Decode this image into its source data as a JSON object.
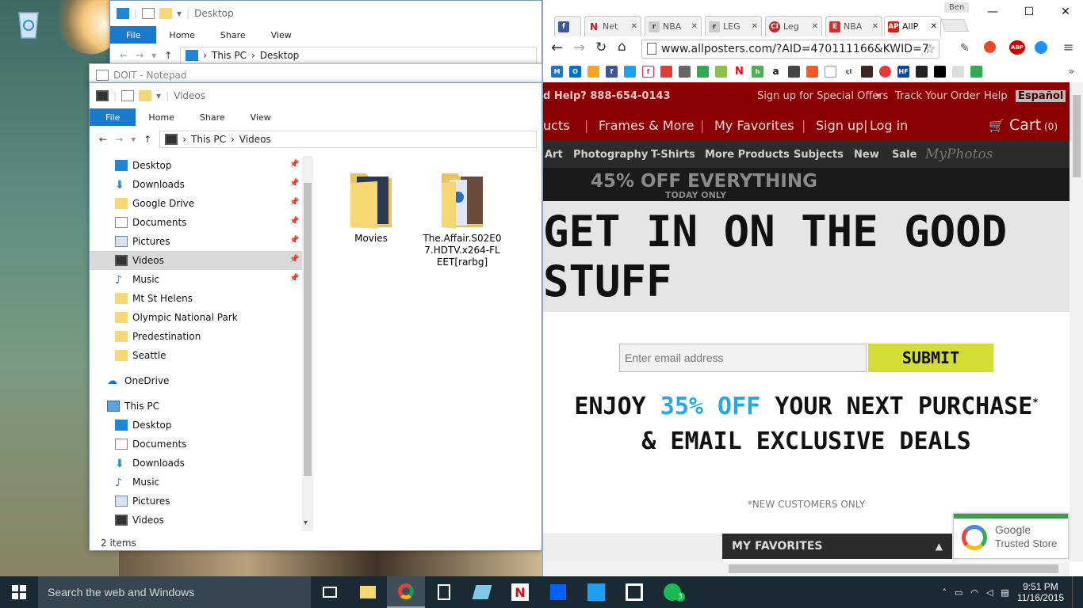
{
  "desktop": {
    "recycle_bin_label": ""
  },
  "explorer_back": {
    "title": "Desktop",
    "tabs": [
      "File",
      "Home",
      "Share",
      "View"
    ],
    "path": [
      "This PC",
      "Desktop"
    ]
  },
  "notepad": {
    "title": "DOIT - Notepad"
  },
  "explorer": {
    "title": "Videos",
    "tabs": [
      "File",
      "Home",
      "Share",
      "View"
    ],
    "path": [
      "This PC",
      "Videos"
    ],
    "quick_access": [
      {
        "label": "Desktop",
        "icon": "desktop-icon"
      },
      {
        "label": "Downloads",
        "icon": "download-icon"
      },
      {
        "label": "Google Drive",
        "icon": "folder-icon"
      },
      {
        "label": "Documents",
        "icon": "documents-icon"
      },
      {
        "label": "Pictures",
        "icon": "pictures-icon"
      },
      {
        "label": "Videos",
        "icon": "videos-icon"
      },
      {
        "label": "Music",
        "icon": "music-icon"
      },
      {
        "label": "Mt St Helens",
        "icon": "folder-icon"
      },
      {
        "label": "Olympic National Park",
        "icon": "folder-icon"
      },
      {
        "label": "Predestination",
        "icon": "folder-icon"
      },
      {
        "label": "Seattle",
        "icon": "folder-icon"
      }
    ],
    "onedrive": "OneDrive",
    "this_pc": "This PC",
    "this_pc_items": [
      "Desktop",
      "Documents",
      "Downloads",
      "Music",
      "Pictures",
      "Videos"
    ],
    "files": [
      {
        "name": "Movies"
      },
      {
        "name": "The.Affair.S02E07.HDTV.x264-FLEET[rarbg]"
      }
    ],
    "status": "2 items"
  },
  "chrome": {
    "user": "Ben",
    "tabs": [
      {
        "label": "",
        "fav": "f",
        "color": "#3b5998"
      },
      {
        "label": "Net",
        "fav": "N",
        "color": "#e50914"
      },
      {
        "label": "NBA",
        "fav": "r",
        "color": "#888888"
      },
      {
        "label": "LEG",
        "fav": "r",
        "color": "#888888"
      },
      {
        "label": "Leg",
        "fav": "CI",
        "color": "#c62828"
      },
      {
        "label": "NBA",
        "fav": "E",
        "color": "#d32f2f"
      },
      {
        "label": "AllP",
        "fav": "AP",
        "color": "#d81e05"
      }
    ],
    "url": "www.allposters.com/?AID=470111166&KWID=7"
  },
  "site": {
    "help": "d Help? 888-654-0143",
    "special_offers": "Sign up for Special Offers",
    "track_order": "Track Your Order",
    "help_link": "Help",
    "espanol": "Español",
    "nav1": [
      "ucts",
      "Frames & More",
      "My Favorites",
      "Sign up",
      "Log in"
    ],
    "cart": "Cart",
    "cart_count": "(0)",
    "nav2": [
      "Art",
      "Photography",
      "T-Shirts",
      "More Products",
      "Subjects",
      "New",
      "Sale"
    ],
    "myphotos": "MyPhotos",
    "promo": "45% OFF EVERYTHING",
    "promo_sub": "TODAY ONLY",
    "headline": "GET IN ON THE GOOD STUFF",
    "email_placeholder": "Enter email address",
    "submit": "SUBMIT",
    "enjoy_prefix": "ENJOY ",
    "enjoy_accent": "35% OFF",
    "enjoy_suffix": " YOUR NEXT PURCHASE",
    "enjoy_line2": "& EMAIL EXCLUSIVE DEALS",
    "new_customers": "*NEW CUSTOMERS ONLY",
    "my_favorites": "MY FAVORITES",
    "google": "Google",
    "trusted": "Trusted Store"
  },
  "taskbar": {
    "search": "Search the web and Windows",
    "time": "9:51 PM",
    "date": "11/16/2015",
    "spotify_badge": "3"
  }
}
